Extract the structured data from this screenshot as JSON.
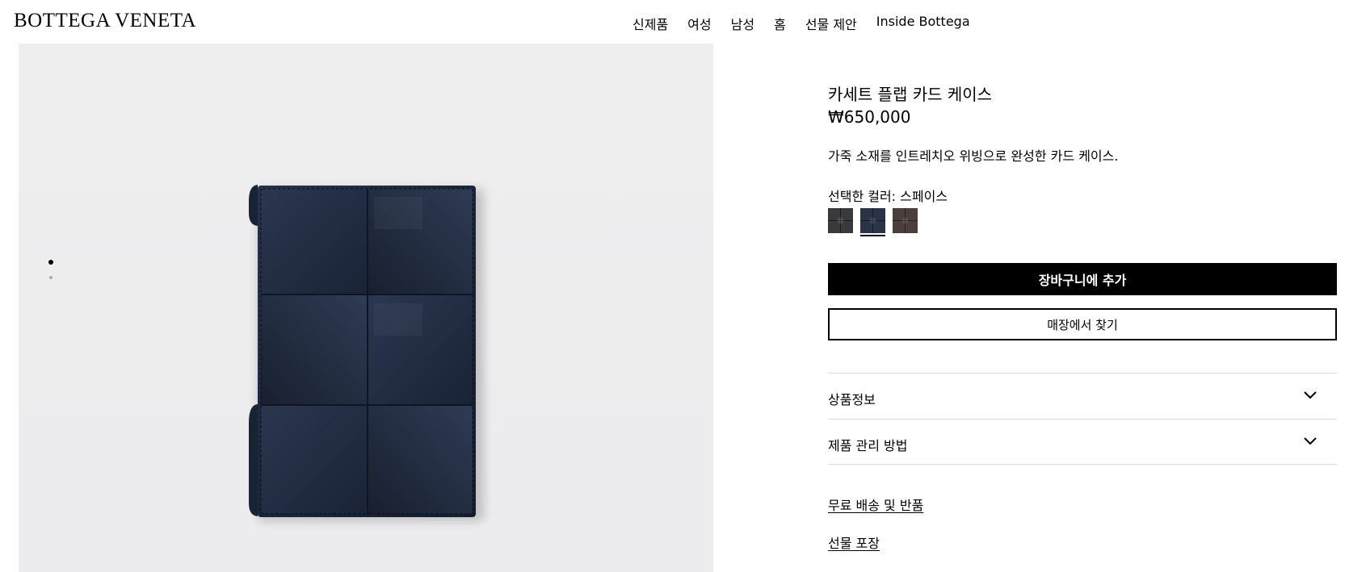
{
  "header": {
    "logo": "BOTTEGA VENETA",
    "nav": [
      "신제품",
      "여성",
      "남성",
      "홈",
      "선물 제안",
      "Inside Bottega"
    ]
  },
  "product": {
    "title": "카세트 플랩 카드 케이스",
    "price": "₩650,000",
    "description": "가죽 소재를 인트레치오 위빙으로 완성한 카드 케이스.",
    "color_label": "선택한 컬러: 스페이스",
    "swatches": [
      {
        "name": "dark-grey",
        "color": "#3a3a3c",
        "selected": false
      },
      {
        "name": "space",
        "color": "#2a3446",
        "selected": true
      },
      {
        "name": "brown",
        "color": "#4a3f3c",
        "selected": false
      }
    ],
    "image_color": "#1f2a3a"
  },
  "actions": {
    "add_to_cart": "장바구니에 추가",
    "find_in_store": "매장에서 찾기"
  },
  "accordions": [
    {
      "label": "상품정보"
    },
    {
      "label": "제품 관리 방법"
    }
  ],
  "links": {
    "shipping": "무료 배송 및 반품",
    "gift": "선물 포장"
  },
  "carousel": {
    "active_index": 0,
    "count": 2
  }
}
